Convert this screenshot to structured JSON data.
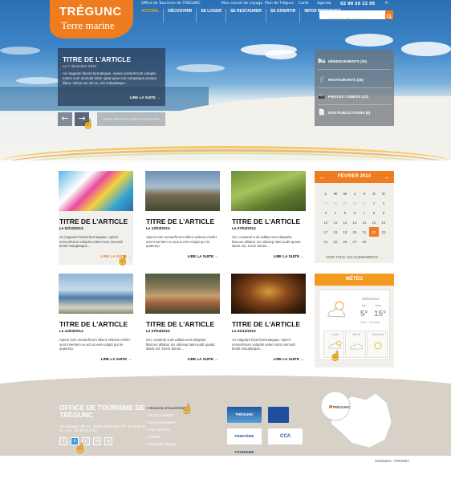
{
  "topbar": {
    "office": "Office de Tourisme de TRÉGUNC",
    "carnet": "Mon carnet de voyage",
    "plan": "Plan de Trégunc",
    "carte": "Carte",
    "agenda": "Agenda",
    "phone": "02 98 50 22 05",
    "lang": "Fr"
  },
  "logo": {
    "line1": "TRÉGUNC",
    "line2": "Terre marine"
  },
  "nav": [
    "Accueil",
    "Découvrir",
    "Se loger",
    "Se restaurer",
    "Se divertir",
    "Infos pratiques"
  ],
  "search": {
    "placeholder": "... restaurant, gîte, camping ..."
  },
  "hero_article": {
    "title": "TITRE DE L'ARTICLE",
    "date": "Le 7 décembre 2013",
    "text": "As magnam facerit bernatquae. Apieni nonserferum voluptis estem sunt ommodi debe optat quas eos volupatque prorpor iliiant, minus aut vel ex, ent molupitaque...",
    "more": "LIRE LA SUITE →"
  },
  "hero_controls": {
    "prev": "←",
    "next": "→",
    "all": "VOIR TOUTES LES ACTUALITÉS"
  },
  "quick_links": [
    {
      "icon": "bed-icon",
      "glyph": "🛏",
      "label": "HÉBERGEMENTS (25)"
    },
    {
      "icon": "fork-knife-icon",
      "glyph": "🍴",
      "label": "RESTAURANTS (45)"
    },
    {
      "icon": "camera-icon",
      "glyph": "📷",
      "label": "PHOTOS / VIDÉOS (12)"
    },
    {
      "icon": "document-icon",
      "glyph": "📄",
      "label": "NOS PUBLICATIONS (8)"
    }
  ],
  "articles": [
    {
      "title": "TITRE DE L'ARTICLE",
      "date": "Le 02/12/2013",
      "text": "As magnam facerit bernatquae. Apieni nonserferum voluptis estem sunt ommodi bestit molupitaque...",
      "more": "LIRE LA SUITE →"
    },
    {
      "title": "TITRE DE L'ARTICLE",
      "date": "Le 12/03/2014",
      "text": "Apieni num nonserferum viliero velesse nimfer sunt inventem es accus eiet volupti qui im quatemp.",
      "more": "LIRE LA SUITE →"
    },
    {
      "title": "TITRE DE L'ARTICLE",
      "date": "Le 07/04/2014",
      "text": "Um, cusamet a de adlata vent doluptist blaccus alliabor aci odissep tatet audit quatur, aliam est, lorem duntur...",
      "more": "LIRE LA SUITE →"
    },
    {
      "title": "TITRE DE L'ARTICLE",
      "date": "Le 12/03/2014",
      "text": "Apieni num nonserferum viliero velesse nimfer sunt inventem es accus eiet volupti qui im quatemp.",
      "more": "LIRE LA SUITE →"
    },
    {
      "title": "TITRE DE L'ARTICLE",
      "date": "Le 07/04/2014",
      "text": "Um, cusamet a de adlata vent doluptist blaccus alliabor aci odissep tatet audit quatur, aliam est, lorem duntur...",
      "more": "LIRE LA SUITE →"
    },
    {
      "title": "TITRE DE L'ARTICLE",
      "date": "Le 02/12/2013",
      "text": "As magnam facerit bernatquae. Apieni nonserferum voluptis estem sunt ommodi bestit molupitaque...",
      "more": "LIRE LA SUITE →"
    }
  ],
  "calendar": {
    "month": "FÉVRIER 2014",
    "prev": "←",
    "next": "→",
    "weekdays": [
      "L",
      "M",
      "M",
      "J",
      "V",
      "S",
      "D"
    ],
    "weeks": [
      [
        "27",
        "28",
        "29",
        "30",
        "31",
        "1",
        "2"
      ],
      [
        "3",
        "4",
        "5",
        "6",
        "7",
        "8",
        "9"
      ],
      [
        "10",
        "11",
        "12",
        "13",
        "14",
        "15",
        "16"
      ],
      [
        "17",
        "18",
        "19",
        "20",
        "21",
        "22",
        "23"
      ],
      [
        "24",
        "25",
        "26",
        "27",
        "28",
        "",
        ""
      ]
    ],
    "today": "22",
    "all": "VOIR TOUS LES ÉVÉNEMENTS →"
  },
  "meteo": {
    "title": "MÉTÉO",
    "date": "20/02/2014",
    "min_label": "Min.",
    "max_label": "Max.",
    "min": "5°",
    "max": "15°",
    "wind": "Vent : 25 km/h",
    "days": [
      "Lundi",
      "Mardi",
      "Mercredi"
    ]
  },
  "footer": {
    "office": "OFFICE DE TOURISME DE TRÉGUNC",
    "address": "Kerambourg - BP 24 - 29910 TRÉGUNC Tél : 02 98 50 22 05 - Fax : 02 98 50 18 60",
    "social": [
      "f",
      "t",
      "y",
      "in",
      "p"
    ],
    "links": [
      "Horaires d'ouverture",
      "Nous contacter",
      "Nos partenaires",
      "Plan d'accès",
      "Crédits",
      "Mentions légales"
    ],
    "map_label": "TRÉGUNC",
    "partners": [
      "TRÉGUNC",
      "",
      "FINISTÈRE TOURISME",
      "CCA"
    ]
  },
  "credit": "Réalisation : PRIMSET",
  "colors": {
    "accent": "#ef7d1f",
    "footer": "#d7d1c8"
  }
}
